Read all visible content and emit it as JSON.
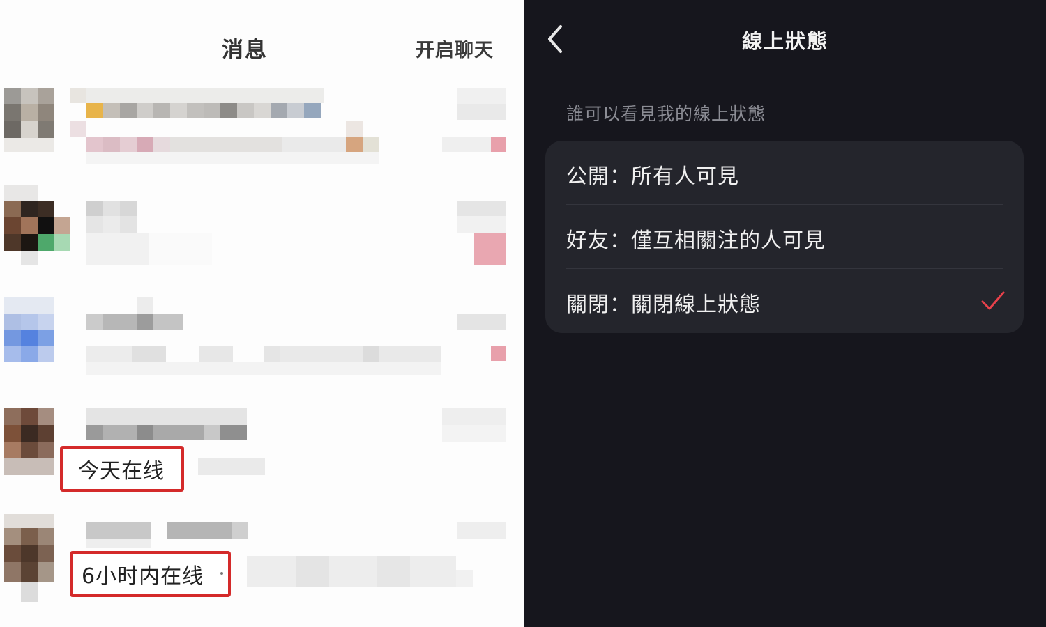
{
  "left_panel": {
    "title": "消息",
    "start_chat": "开启聊天",
    "status_labels": [
      "今天在线",
      "6小时内在线"
    ]
  },
  "right_panel": {
    "title": "線上狀態",
    "section_label": "誰可以看見我的線上狀態",
    "options": [
      {
        "label": "公開：所有人可見",
        "selected": false
      },
      {
        "label": "好友：僅互相關注的人可見",
        "selected": false
      },
      {
        "label": "關閉：關閉線上狀態",
        "selected": true
      }
    ],
    "icons": {
      "back": "chevron-left-icon",
      "check": "checkmark-icon"
    },
    "colors": {
      "background": "#16161d",
      "card": "#24252c",
      "check": "#e8414b"
    }
  }
}
